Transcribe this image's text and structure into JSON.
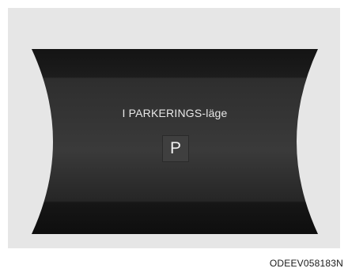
{
  "display": {
    "message": "I PARKERINGS-läge",
    "gear": "P"
  },
  "figure_code": "ODEEV058183N",
  "colors": {
    "panel_background": "#e6e6e6",
    "display_dark": "#111111",
    "display_mid": "#3a3a3a",
    "text": "#e8e8e8"
  }
}
